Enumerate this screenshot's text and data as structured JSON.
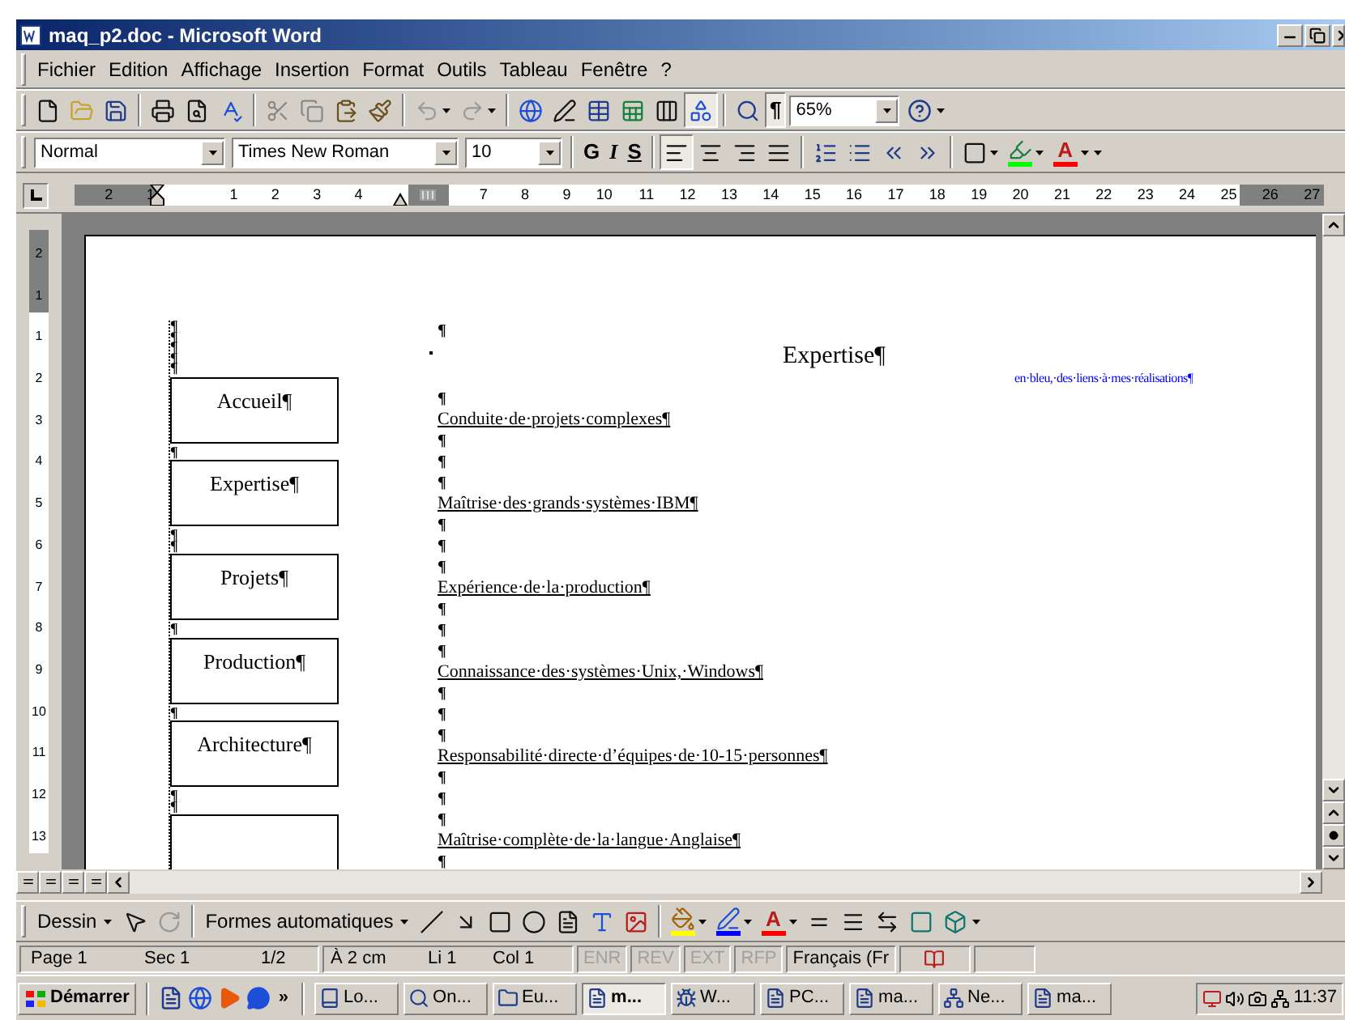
{
  "window": {
    "title": "maq_p2.doc - Microsoft Word"
  },
  "menu": [
    "Fichier",
    "Edition",
    "Affichage",
    "Insertion",
    "Format",
    "Outils",
    "Tableau",
    "Fenêtre",
    "?"
  ],
  "standard_toolbar": {
    "buttons": [
      {
        "kind": "new",
        "pressed": false
      },
      {
        "kind": "open",
        "pressed": false
      },
      {
        "kind": "save",
        "pressed": false
      },
      {
        "kind": "sep"
      },
      {
        "kind": "print",
        "pressed": false
      },
      {
        "kind": "preview",
        "pressed": false
      },
      {
        "kind": "spell",
        "pressed": false
      },
      {
        "kind": "sep"
      },
      {
        "kind": "cut",
        "pressed": false
      },
      {
        "kind": "copy",
        "pressed": false
      },
      {
        "kind": "paste",
        "pressed": false
      },
      {
        "kind": "painter",
        "pressed": false
      },
      {
        "kind": "sep"
      },
      {
        "kind": "undo",
        "pressed": false
      },
      {
        "kind": "redo",
        "pressed": false
      },
      {
        "kind": "sep"
      },
      {
        "kind": "web",
        "pressed": false
      },
      {
        "kind": "draw-table",
        "pressed": false
      },
      {
        "kind": "table",
        "pressed": false
      },
      {
        "kind": "sheet",
        "pressed": false
      },
      {
        "kind": "columns",
        "pressed": false
      },
      {
        "kind": "drawing",
        "pressed": true
      },
      {
        "kind": "sep"
      },
      {
        "kind": "docmap",
        "pressed": false
      },
      {
        "kind": "marks",
        "label": "¶",
        "pressed": true
      }
    ],
    "zoom": "65%"
  },
  "formatting_toolbar": {
    "style": "Normal",
    "font": "Times New Roman",
    "size": "10",
    "buttons": [
      {
        "kind": "bold",
        "label": "G",
        "pressed": false
      },
      {
        "kind": "italic",
        "label": "I",
        "pressed": false
      },
      {
        "kind": "underline",
        "label": "S",
        "pressed": false
      },
      {
        "kind": "sep"
      },
      {
        "kind": "align-left",
        "pressed": true
      },
      {
        "kind": "align-center",
        "pressed": false
      },
      {
        "kind": "align-right",
        "pressed": false
      },
      {
        "kind": "justify",
        "pressed": false
      },
      {
        "kind": "sep"
      },
      {
        "kind": "numbering",
        "pressed": false
      },
      {
        "kind": "bullets",
        "pressed": false
      },
      {
        "kind": "outdent",
        "pressed": false
      },
      {
        "kind": "indent",
        "pressed": false
      },
      {
        "kind": "sep"
      },
      {
        "kind": "borders",
        "pressed": false
      },
      {
        "kind": "highlight",
        "pressed": false
      },
      {
        "kind": "font-color",
        "label": "A",
        "pressed": false
      }
    ]
  },
  "ruler": [
    {
      "label": "2",
      "shaded": true
    },
    {
      "label": "1",
      "shaded": true
    },
    {
      "kind": "indent"
    },
    {
      "label": "1",
      "shaded": false
    },
    {
      "label": "2",
      "shaded": false
    },
    {
      "label": "3",
      "shaded": false
    },
    {
      "label": "4",
      "shaded": false
    },
    {
      "kind": "margin"
    },
    {
      "kind": "column"
    },
    {
      "label": "7",
      "shaded": false
    },
    {
      "label": "8",
      "shaded": false
    },
    {
      "label": "9",
      "shaded": false
    },
    {
      "label": "10",
      "shaded": false
    },
    {
      "label": "11",
      "shaded": false
    },
    {
      "label": "12",
      "shaded": false
    },
    {
      "label": "13",
      "shaded": false
    },
    {
      "label": "14",
      "shaded": false
    },
    {
      "label": "15",
      "shaded": false
    },
    {
      "label": "16",
      "shaded": false
    },
    {
      "label": "17",
      "shaded": false
    },
    {
      "label": "18",
      "shaded": false
    },
    {
      "label": "19",
      "shaded": false
    },
    {
      "label": "20",
      "shaded": false
    },
    {
      "label": "21",
      "shaded": false
    },
    {
      "label": "22",
      "shaded": false
    },
    {
      "label": "23",
      "shaded": false
    },
    {
      "label": "24",
      "shaded": false
    },
    {
      "label": "25",
      "shaded": false
    },
    {
      "label": "26",
      "shaded": true
    },
    {
      "label": "27",
      "shaded": true
    }
  ],
  "vertical_ruler": [
    {
      "label": "2",
      "shaded": true
    },
    {
      "label": "1",
      "shaded": true
    },
    {
      "label": "1",
      "shaded": false
    },
    {
      "label": "2",
      "shaded": false
    },
    {
      "label": "3",
      "shaded": false
    },
    {
      "label": "4",
      "shaded": false
    },
    {
      "label": "5",
      "shaded": false
    },
    {
      "label": "6",
      "shaded": false
    },
    {
      "label": "7",
      "shaded": false
    },
    {
      "label": "8",
      "shaded": false
    },
    {
      "label": "9",
      "shaded": false
    },
    {
      "label": "10",
      "shaded": false
    },
    {
      "label": "11",
      "shaded": false
    },
    {
      "label": "12",
      "shaded": false
    },
    {
      "label": "13",
      "shaded": false
    }
  ],
  "document": {
    "left_column": [
      {
        "kind": "mark",
        "text": "¶"
      },
      {
        "kind": "mark",
        "text": "¶"
      },
      {
        "kind": "mark",
        "text": "¶"
      },
      {
        "kind": "mark",
        "text": "¶"
      },
      {
        "kind": "mark",
        "text": "¶"
      },
      {
        "kind": "box",
        "text": "Accueil¶"
      },
      {
        "kind": "mark",
        "text": "¶"
      },
      {
        "kind": "box",
        "text": "Expertise¶"
      },
      {
        "kind": "mark",
        "text": "¶"
      },
      {
        "kind": "mark",
        "text": "¶"
      },
      {
        "kind": "box",
        "text": "Projets¶"
      },
      {
        "kind": "mark",
        "text": "¶"
      },
      {
        "kind": "box",
        "text": "Production¶"
      },
      {
        "kind": "mark",
        "text": "¶"
      },
      {
        "kind": "box",
        "text": "Architecture¶"
      },
      {
        "kind": "mark",
        "text": "¶"
      },
      {
        "kind": "mark",
        "text": "¶"
      },
      {
        "kind": "box"
      }
    ],
    "heading": "Expertise¶",
    "note": "en·bleu,·des·liens·à·mes·réalisations¶",
    "right_column": [
      {
        "kind": "mark",
        "text": "¶"
      },
      {
        "kind": "anchor"
      },
      {
        "kind": "gap"
      },
      {
        "kind": "mark",
        "text": "¶"
      },
      {
        "kind": "link",
        "text": "Conduite·de·projets·complexes¶"
      },
      {
        "kind": "mark",
        "text": "¶"
      },
      {
        "kind": "mark",
        "text": "¶"
      },
      {
        "kind": "mark",
        "text": "¶"
      },
      {
        "kind": "link",
        "text": "Maîtrise·des·grands·systèmes·IBM¶"
      },
      {
        "kind": "mark",
        "text": "¶"
      },
      {
        "kind": "mark",
        "text": "¶"
      },
      {
        "kind": "mark",
        "text": "¶"
      },
      {
        "kind": "link",
        "text": "Expérience·de·la·production¶"
      },
      {
        "kind": "mark",
        "text": "¶"
      },
      {
        "kind": "mark",
        "text": "¶"
      },
      {
        "kind": "mark",
        "text": "¶"
      },
      {
        "kind": "link",
        "text": "Connaissance·des·systèmes·Unix,·Windows¶"
      },
      {
        "kind": "mark",
        "text": "¶"
      },
      {
        "kind": "mark",
        "text": "¶"
      },
      {
        "kind": "mark",
        "text": "¶"
      },
      {
        "kind": "link",
        "text": "Responsabilité·directe·d’équipes·de·10-15·personnes¶"
      },
      {
        "kind": "mark",
        "text": "¶"
      },
      {
        "kind": "mark",
        "text": "¶"
      },
      {
        "kind": "mark",
        "text": "¶"
      },
      {
        "kind": "link",
        "text": "Maîtrise·complète·de·la·langue·Anglaise¶"
      },
      {
        "kind": "mark",
        "text": "¶"
      }
    ]
  },
  "drawing_toolbar": {
    "draw_menu": "Dessin",
    "autoshapes": "Formes automatiques",
    "buttons": [
      {
        "kind": "pointer",
        "pressed": false
      },
      {
        "kind": "rotate",
        "pressed": false
      },
      {
        "kind": "sep"
      },
      {
        "kind": "autoshapes"
      },
      {
        "kind": "line",
        "pressed": false
      },
      {
        "kind": "arrow",
        "pressed": false
      },
      {
        "kind": "rectangle",
        "pressed": false
      },
      {
        "kind": "ellipse",
        "pressed": false
      },
      {
        "kind": "textbox",
        "pressed": false
      },
      {
        "kind": "wordart",
        "pressed": false
      },
      {
        "kind": "clipart",
        "pressed": false
      },
      {
        "kind": "sep"
      },
      {
        "kind": "fill",
        "pressed": false
      },
      {
        "kind": "line-color",
        "pressed": false
      },
      {
        "kind": "font-color",
        "label": "A",
        "pressed": false
      },
      {
        "kind": "line-style",
        "pressed": false
      },
      {
        "kind": "dash-style",
        "pressed": false
      },
      {
        "kind": "arrow-style",
        "pressed": false
      },
      {
        "kind": "shadow",
        "pressed": false
      },
      {
        "kind": "extrusion",
        "pressed": false
      }
    ]
  },
  "status_bar": {
    "page": "Page 1",
    "section": "Sec 1",
    "pages": "1/2",
    "position": "À 2 cm",
    "line": "Li 1",
    "column": "Col 1",
    "indicators": [
      {
        "label": "ENR",
        "enabled": false
      },
      {
        "label": "REV",
        "enabled": false
      },
      {
        "label": "EXT",
        "enabled": false
      },
      {
        "label": "RFP",
        "enabled": false
      }
    ],
    "language": "Français (Fr"
  },
  "taskbar": {
    "start": "Démarrer",
    "more": "»",
    "tasks": [
      {
        "label": "Lo...",
        "selected": false
      },
      {
        "label": "On...",
        "selected": false
      },
      {
        "label": "Eu...",
        "selected": false
      },
      {
        "label": "m...",
        "selected": true
      },
      {
        "label": "W...",
        "selected": false
      },
      {
        "label": "PC...",
        "selected": false
      },
      {
        "label": "ma...",
        "selected": false
      },
      {
        "label": "Ne...",
        "selected": false
      },
      {
        "label": "ma...",
        "selected": false
      }
    ],
    "time": "11:37"
  }
}
